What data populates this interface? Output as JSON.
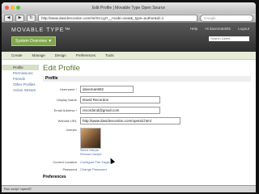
{
  "browser": {
    "title": "Edit Profile | Movable Type Open Source",
    "url": "http://www.davidrecordon.com/mt/mt.cgi?__mode=view&_type=author&id=1",
    "search_placeholder": "Google",
    "status": "Run script \"openID\""
  },
  "mt_header": {
    "logo": "MOVABLE TYPE™",
    "help": "Help",
    "greeting": "Hi daveman692",
    "logout": "Logout",
    "overview_button": "System Overview ▼",
    "search_placeholder": "Search Users"
  },
  "menu": [
    "Create",
    "Manage",
    "Design",
    "Preferences",
    "Tools"
  ],
  "sidebar": {
    "items": [
      {
        "label": "Profile",
        "active": true
      },
      {
        "label": "Permissions"
      },
      {
        "label": "Friends"
      },
      {
        "label": "Other Profiles"
      },
      {
        "label": "Action Stream"
      }
    ]
  },
  "page": {
    "title": "Edit Profile",
    "section": "Profile",
    "fields": [
      {
        "label": "Username *",
        "value": "daveman692"
      },
      {
        "label": "Display Name",
        "value": "David Recordon"
      },
      {
        "label": "Email Address *",
        "value": "recordond@gmail.com"
      },
      {
        "label": "Website URL",
        "value": "http://www.davidrecordon.com/openid.html"
      }
    ],
    "userpic": {
      "label": "Userpic",
      "select": "Select Userpic",
      "remove": "Remove Userpic"
    },
    "current_location": {
      "label": "Current Location",
      "value": "Configure Fire Eagle"
    },
    "password": {
      "label": "Password",
      "value": "Change Password"
    },
    "preferences": "Preferences"
  },
  "colors": {
    "accent": "#7fa64a",
    "link": "#4a6b9c"
  }
}
